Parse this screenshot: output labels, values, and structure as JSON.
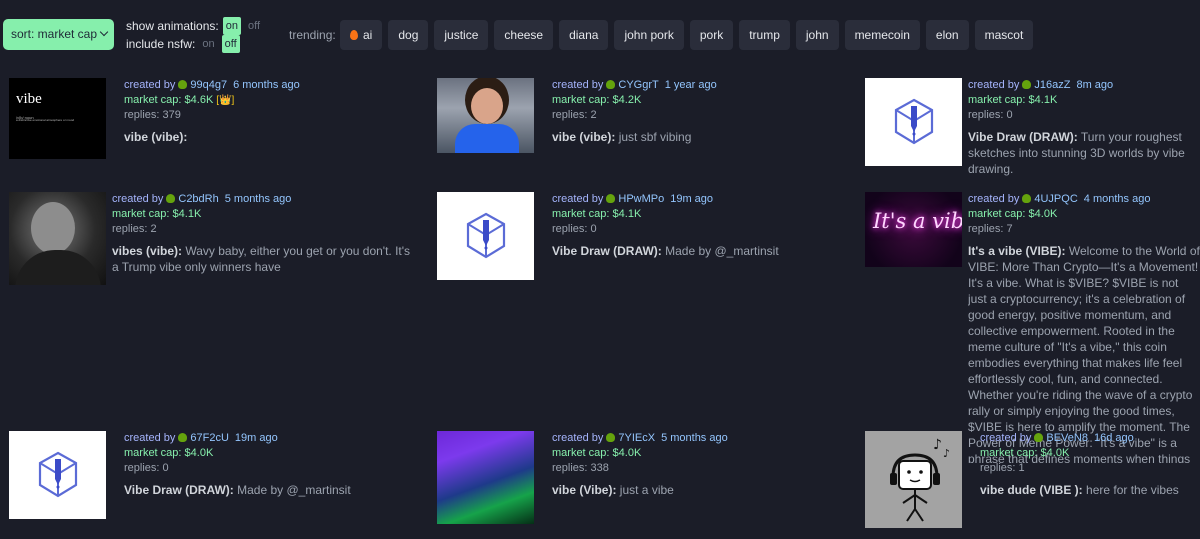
{
  "header": {
    "sort_label": "sort: market cap",
    "show_animations_label": "show animations:",
    "include_nsfw_label": "include nsfw:",
    "on_label": "on",
    "off_label": "off",
    "show_animations_state": "on",
    "include_nsfw_state": "off",
    "trending_label": "trending:",
    "trending": [
      "ai",
      "dog",
      "justice",
      "cheese",
      "diana",
      "john pork",
      "pork",
      "trump",
      "john",
      "memecoin",
      "elon",
      "mascot"
    ]
  },
  "labels": {
    "created_by": "created by",
    "replies": "replies:",
    "market_cap": "market cap:"
  },
  "colors": {
    "accent_green": "#86efac",
    "background": "#1b1d28",
    "chip_bg": "#2a2d3a",
    "creator_blue": "#93c5fd"
  },
  "cards": [
    {
      "creator": "99q4g7",
      "age": "6 months ago",
      "market_cap": "$4.6K",
      "replies": "379",
      "name": "vibe (vibe):",
      "description": "",
      "king_badge": "[👑]",
      "thumb": "vibe",
      "thumb_text": "vibe",
      "thumb_sub": "/vīb/ noun",
      "thumb_def": "a distinctive emotional atmosphere or mood"
    },
    {
      "creator": "CYGgrT",
      "age": "1 year ago",
      "market_cap": "$4.2K",
      "replies": "2",
      "name": "vibe (vibe):",
      "description": "just sbf vibing",
      "thumb": "person"
    },
    {
      "creator": "J16azZ",
      "age": "8m ago",
      "market_cap": "$4.1K",
      "replies": "0",
      "name": "Vibe Draw (DRAW):",
      "description": "Turn your roughest sketches into stunning 3D worlds by vibe drawing.",
      "thumb": "logo"
    },
    {
      "creator": "C2bdRh",
      "age": "5 months ago",
      "market_cap": "$4.1K",
      "replies": "2",
      "name": "vibes (vibe):",
      "description": "Wavy baby, either you get or you don't. It's a Trump vibe only winners have",
      "thumb": "dark"
    },
    {
      "creator": "HPwMPo",
      "age": "19m ago",
      "market_cap": "$4.1K",
      "replies": "0",
      "name": "Vibe Draw (DRAW):",
      "description": "Made by @_martinsit",
      "thumb": "logo"
    },
    {
      "creator": "4UJPQC",
      "age": "4 months ago",
      "market_cap": "$4.0K",
      "replies": "7",
      "name": "It's a vibe (VIBE):",
      "description": "Welcome to the World of VIBE: More Than Crypto—It's a Movement! It's a vibe. What is $VIBE? $VIBE is not just a cryptocurrency; it's a celebration of good energy, positive momentum, and collective empowerment. Rooted in the meme culture of \"It's a vibe,\" this coin embodies everything that makes life feel effortlessly cool, fun, and connected. Whether you're riding the wave of a crypto rally or simply enjoying the good times, $VIBE is here to amplify the moment. The Power of Meme Power: \"It's a vibe\" is a phrase that defines moments when things feel just right, and $VIBE turns that feeling into a movement. By blending community, driven by",
      "thumb": "neon",
      "thumb_text": "It's a vibe"
    },
    {
      "creator": "67F2cU",
      "age": "19m ago",
      "market_cap": "$4.0K",
      "replies": "0",
      "name": "Vibe Draw (DRAW):",
      "description": "Made by @_martinsit",
      "thumb": "logo"
    },
    {
      "creator": "7YIEcX",
      "age": "5 months ago",
      "market_cap": "$4.0K",
      "replies": "338",
      "name": "vibe (Vibe):",
      "description": "just a vibe",
      "thumb": "club"
    },
    {
      "creator": "BEVeN8",
      "age": "16d ago",
      "market_cap": "$4.0K",
      "replies": "1",
      "name": "vibe dude (VIBE ):",
      "description": "here for the vibes",
      "thumb": "dude"
    }
  ]
}
